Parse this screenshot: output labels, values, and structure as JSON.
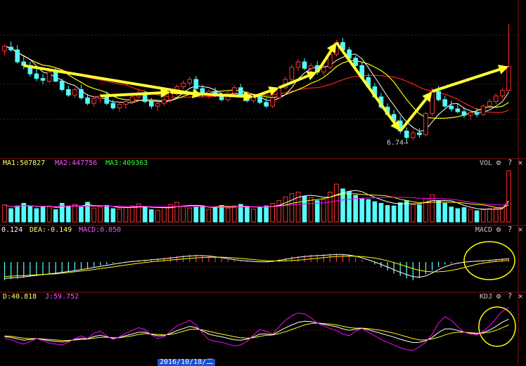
{
  "panels": {
    "vol": {
      "name": "VOL",
      "ma1_label": "MA1:507827",
      "ma2_label": "MA2:447756",
      "ma3_label": "MA3:409363"
    },
    "macd": {
      "name": "MACD",
      "dif_label": "0.124",
      "dea_label": "DEA:-0.149",
      "macd_label": "MACD:0.050"
    },
    "kdj": {
      "name": "KDJ",
      "d_label": "D:40.818",
      "j_label": "J:59.752"
    }
  },
  "controls": {
    "settings": "⚙",
    "help": "?",
    "close": "✕"
  },
  "annotations": {
    "low_price": "6.74→"
  },
  "date_cursor": "2016/10/18/二",
  "colors": {
    "background": "#000000",
    "up": "#ff3232",
    "down": "#54fcfc",
    "ma_white": "#ffffff",
    "ma_yellow": "#ffff00",
    "ma_magenta": "#ff00ff",
    "ma_green": "#00e600",
    "arrow": "#ffff33",
    "circle": "#ffff00",
    "grid": "#551a1a"
  },
  "chart_data": [
    {
      "type": "candlestick",
      "ylim": [
        6.5,
        9.7
      ],
      "annotations": [
        "6.74→"
      ],
      "candles": [
        [
          8.72,
          8.86,
          8.62,
          8.82
        ],
        [
          8.8,
          8.92,
          8.7,
          8.74
        ],
        [
          8.74,
          8.84,
          8.44,
          8.48
        ],
        [
          8.48,
          8.6,
          8.32,
          8.4
        ],
        [
          8.4,
          8.48,
          8.16,
          8.22
        ],
        [
          8.22,
          8.32,
          8.06,
          8.12
        ],
        [
          8.12,
          8.22,
          8.0,
          8.08
        ],
        [
          8.06,
          8.3,
          8.02,
          8.26
        ],
        [
          8.26,
          8.34,
          8.04,
          8.06
        ],
        [
          8.06,
          8.12,
          7.84,
          7.88
        ],
        [
          7.88,
          7.96,
          7.72,
          7.76
        ],
        [
          7.76,
          7.92,
          7.7,
          7.88
        ],
        [
          7.88,
          7.98,
          7.66,
          7.7
        ],
        [
          7.7,
          7.78,
          7.54,
          7.58
        ],
        [
          7.58,
          7.74,
          7.5,
          7.68
        ],
        [
          7.68,
          7.8,
          7.6,
          7.74
        ],
        [
          7.74,
          7.84,
          7.54,
          7.58
        ],
        [
          7.58,
          7.66,
          7.44,
          7.48
        ],
        [
          7.48,
          7.62,
          7.4,
          7.56
        ],
        [
          7.56,
          7.68,
          7.46,
          7.62
        ],
        [
          7.62,
          7.78,
          7.56,
          7.72
        ],
        [
          7.72,
          7.88,
          7.64,
          7.8
        ],
        [
          7.8,
          7.86,
          7.58,
          7.62
        ],
        [
          7.62,
          7.7,
          7.46,
          7.52
        ],
        [
          7.52,
          7.62,
          7.42,
          7.58
        ],
        [
          7.58,
          7.72,
          7.52,
          7.66
        ],
        [
          7.66,
          7.86,
          7.6,
          7.82
        ],
        [
          7.82,
          7.98,
          7.74,
          7.94
        ],
        [
          7.94,
          8.08,
          7.88,
          8.02
        ],
        [
          8.02,
          8.16,
          7.96,
          8.1
        ],
        [
          8.1,
          8.18,
          7.86,
          7.9
        ],
        [
          7.9,
          7.98,
          7.72,
          7.76
        ],
        [
          7.76,
          7.88,
          7.68,
          7.84
        ],
        [
          7.84,
          7.92,
          7.72,
          7.76
        ],
        [
          7.76,
          7.82,
          7.62,
          7.66
        ],
        [
          7.66,
          7.84,
          7.62,
          7.8
        ],
        [
          7.8,
          7.98,
          7.74,
          7.92
        ],
        [
          7.92,
          8.0,
          7.72,
          7.76
        ],
        [
          7.76,
          7.84,
          7.6,
          7.64
        ],
        [
          7.64,
          7.76,
          7.58,
          7.72
        ],
        [
          7.72,
          7.8,
          7.56,
          7.6
        ],
        [
          7.6,
          7.7,
          7.48,
          7.52
        ],
        [
          7.52,
          7.74,
          7.48,
          7.7
        ],
        [
          7.7,
          7.96,
          7.66,
          7.92
        ],
        [
          7.92,
          8.16,
          7.88,
          8.1
        ],
        [
          8.1,
          8.42,
          8.06,
          8.36
        ],
        [
          8.36,
          8.54,
          8.28,
          8.48
        ],
        [
          8.48,
          8.56,
          8.3,
          8.34
        ],
        [
          8.34,
          8.46,
          8.24,
          8.4
        ],
        [
          8.4,
          8.5,
          8.2,
          8.26
        ],
        [
          8.26,
          8.42,
          8.18,
          8.36
        ],
        [
          8.36,
          8.7,
          8.32,
          8.64
        ],
        [
          8.64,
          8.96,
          8.6,
          8.9
        ],
        [
          8.9,
          9.0,
          8.7,
          8.74
        ],
        [
          8.74,
          8.8,
          8.52,
          8.56
        ],
        [
          8.56,
          8.62,
          8.36,
          8.4
        ],
        [
          8.4,
          8.48,
          8.1,
          8.14
        ],
        [
          8.14,
          8.22,
          7.9,
          7.94
        ],
        [
          7.94,
          8.02,
          7.7,
          7.72
        ],
        [
          7.72,
          7.8,
          7.46,
          7.5
        ],
        [
          7.5,
          7.58,
          7.3,
          7.34
        ],
        [
          7.34,
          7.44,
          7.14,
          7.2
        ],
        [
          7.2,
          7.3,
          6.92,
          6.98
        ],
        [
          6.98,
          7.06,
          6.74,
          6.84
        ],
        [
          6.84,
          7.0,
          6.78,
          6.94
        ],
        [
          6.94,
          7.04,
          6.84,
          6.9
        ],
        [
          6.9,
          7.4,
          6.86,
          7.36
        ],
        [
          7.36,
          7.92,
          7.3,
          7.84
        ],
        [
          7.84,
          7.96,
          7.62,
          7.66
        ],
        [
          7.66,
          7.74,
          7.48,
          7.52
        ],
        [
          7.52,
          7.64,
          7.4,
          7.46
        ],
        [
          7.46,
          7.58,
          7.36,
          7.4
        ],
        [
          7.4,
          7.5,
          7.26,
          7.32
        ],
        [
          7.32,
          7.42,
          7.22,
          7.38
        ],
        [
          7.38,
          7.48,
          7.28,
          7.34
        ],
        [
          7.34,
          7.56,
          7.3,
          7.52
        ],
        [
          7.52,
          7.68,
          7.46,
          7.62
        ],
        [
          7.62,
          7.8,
          7.56,
          7.74
        ],
        [
          7.74,
          7.9,
          7.68,
          7.86
        ],
        [
          7.86,
          9.3,
          7.84,
          8.38
        ]
      ]
    },
    {
      "type": "bar",
      "title": "VOL",
      "legend": [
        "MA1:507827",
        "MA2:447756",
        "MA3:409363"
      ],
      "ylim": [
        0,
        1000000
      ],
      "values": [
        320000,
        250000,
        300000,
        350000,
        300000,
        250000,
        280000,
        300000,
        230000,
        350000,
        300000,
        330000,
        280000,
        370000,
        260000,
        280000,
        310000,
        250000,
        240000,
        270000,
        300000,
        340000,
        270000,
        230000,
        220000,
        280000,
        330000,
        370000,
        300000,
        260000,
        290000,
        300000,
        240000,
        270000,
        310000,
        260000,
        300000,
        330000,
        280000,
        240000,
        270000,
        300000,
        350000,
        400000,
        470000,
        530000,
        560000,
        480000,
        460000,
        400000,
        420000,
        560000,
        710000,
        620000,
        570000,
        500000,
        440000,
        420000,
        380000,
        350000,
        310000,
        300000,
        360000,
        400000,
        330000,
        320000,
        440000,
        510000,
        400000,
        350000,
        280000,
        250000,
        270000,
        240000,
        210000,
        230000,
        250000,
        260000,
        280000,
        960000
      ]
    },
    {
      "type": "bar",
      "title": "MACD",
      "legend": [
        "0.124",
        "DEA:-0.149",
        "MACD:0.050"
      ],
      "ylim": [
        -0.45,
        0.45
      ],
      "values": [
        -0.3,
        -0.28,
        -0.27,
        -0.26,
        -0.24,
        -0.23,
        -0.22,
        -0.2,
        -0.19,
        -0.17,
        -0.16,
        -0.14,
        -0.12,
        -0.1,
        -0.08,
        -0.06,
        -0.04,
        -0.02,
        0.0,
        0.01,
        0.02,
        0.03,
        0.04,
        0.05,
        0.06,
        0.07,
        0.09,
        0.1,
        0.11,
        0.12,
        0.12,
        0.11,
        0.1,
        0.08,
        0.06,
        0.04,
        0.03,
        0.02,
        0.01,
        0.0,
        0.0,
        0.01,
        0.03,
        0.05,
        0.07,
        0.09,
        0.1,
        0.11,
        0.12,
        0.12,
        0.13,
        0.14,
        0.14,
        0.13,
        0.11,
        0.08,
        0.04,
        0.0,
        -0.04,
        -0.09,
        -0.14,
        -0.19,
        -0.23,
        -0.27,
        -0.3,
        -0.26,
        -0.2,
        -0.14,
        -0.08,
        -0.04,
        -0.02,
        0.0,
        0.01,
        0.02,
        0.02,
        0.03,
        0.04,
        0.05,
        0.06,
        0.07
      ]
    },
    {
      "type": "line",
      "title": "KDJ",
      "legend": [
        "D:40.818",
        "J:59.752"
      ],
      "ylim": [
        -10,
        110
      ],
      "series": [
        {
          "name": "J",
          "values": [
            30,
            28,
            22,
            18,
            24,
            30,
            26,
            20,
            18,
            16,
            22,
            30,
            36,
            30,
            42,
            46,
            36,
            28,
            34,
            42,
            48,
            54,
            50,
            38,
            30,
            34,
            46,
            58,
            64,
            70,
            60,
            42,
            28,
            24,
            22,
            18,
            14,
            16,
            24,
            38,
            50,
            46,
            40,
            56,
            70,
            80,
            86,
            84,
            76,
            64,
            58,
            52,
            48,
            40,
            36,
            46,
            52,
            44,
            36,
            28,
            22,
            16,
            10,
            6,
            4,
            12,
            22,
            40,
            64,
            78,
            70,
            56,
            44,
            40,
            38,
            46,
            58,
            74,
            90,
            98
          ]
        },
        {
          "name": "D",
          "values": [
            36,
            35,
            33,
            31,
            30,
            30,
            29,
            28,
            27,
            26,
            26,
            27,
            28,
            29,
            31,
            33,
            33,
            32,
            32,
            34,
            36,
            39,
            41,
            40,
            39,
            38,
            39,
            42,
            46,
            50,
            51,
            49,
            46,
            43,
            40,
            37,
            34,
            32,
            31,
            32,
            35,
            37,
            38,
            41,
            45,
            50,
            55,
            60,
            63,
            64,
            63,
            62,
            60,
            57,
            54,
            53,
            53,
            52,
            50,
            48,
            45,
            42,
            38,
            34,
            30,
            27,
            27,
            29,
            33,
            38,
            42,
            44,
            44,
            43,
            42,
            42,
            44,
            48,
            54,
            60
          ]
        }
      ]
    }
  ]
}
